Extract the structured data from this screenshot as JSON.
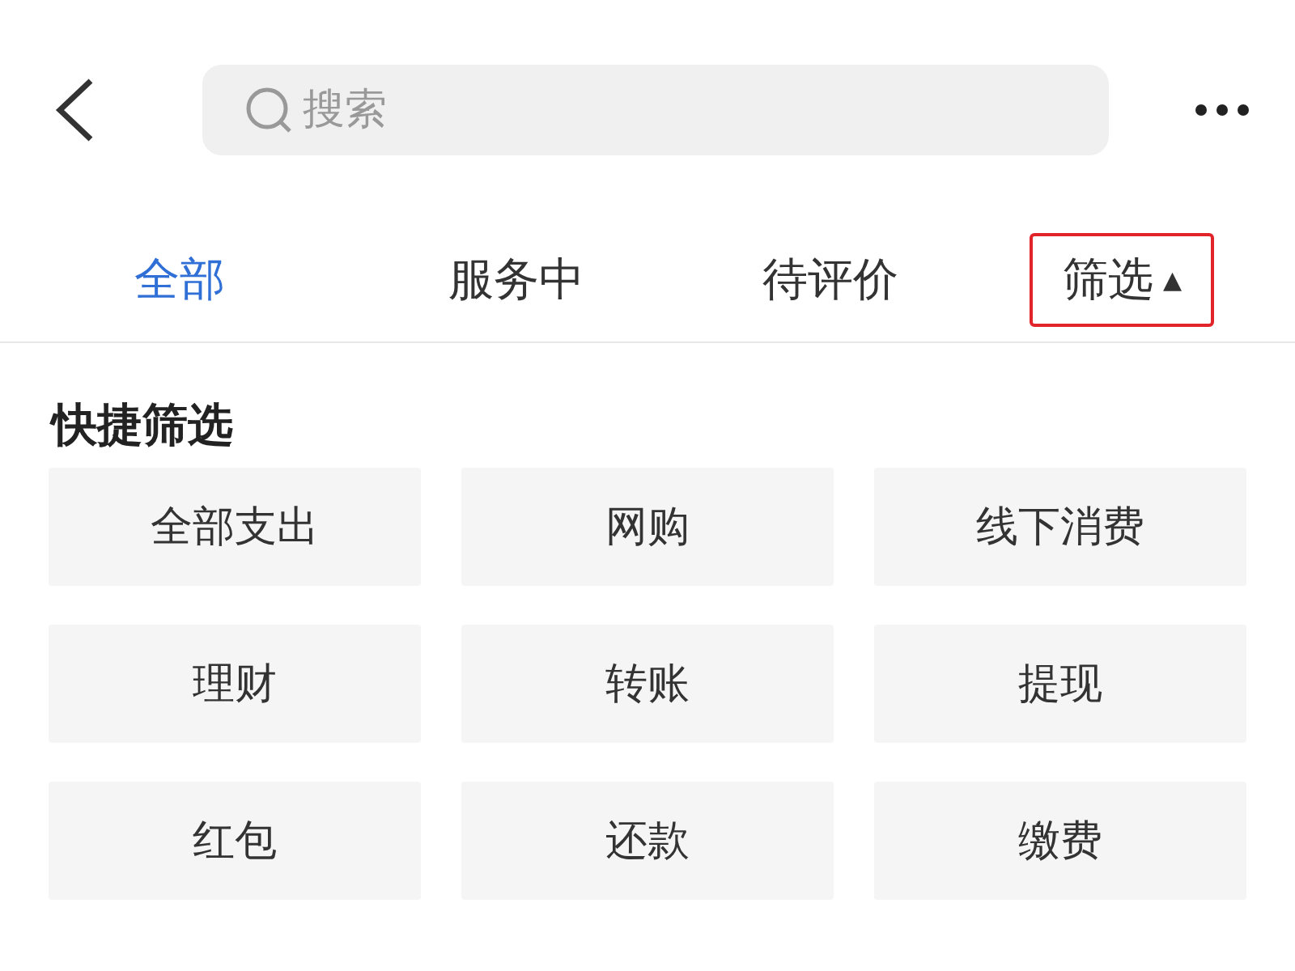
{
  "search": {
    "placeholder": "搜索"
  },
  "tabs": [
    {
      "label": "全部",
      "selected": true
    },
    {
      "label": "服务中",
      "selected": false
    },
    {
      "label": "待评价",
      "selected": false
    }
  ],
  "filter": {
    "label": "筛选",
    "arrow": "▲",
    "highlighted": true
  },
  "quick_filter": {
    "title": "快捷筛选",
    "options": [
      {
        "label": "全部支出",
        "selected": false
      },
      {
        "label": "网购",
        "selected": false
      },
      {
        "label": "线下消费",
        "selected": false
      },
      {
        "label": "理财",
        "selected": false
      },
      {
        "label": "转账",
        "selected": false
      },
      {
        "label": "提现",
        "selected": false
      },
      {
        "label": "红包",
        "selected": false
      },
      {
        "label": "还款",
        "selected": false
      },
      {
        "label": "缴费",
        "selected": false
      }
    ]
  }
}
